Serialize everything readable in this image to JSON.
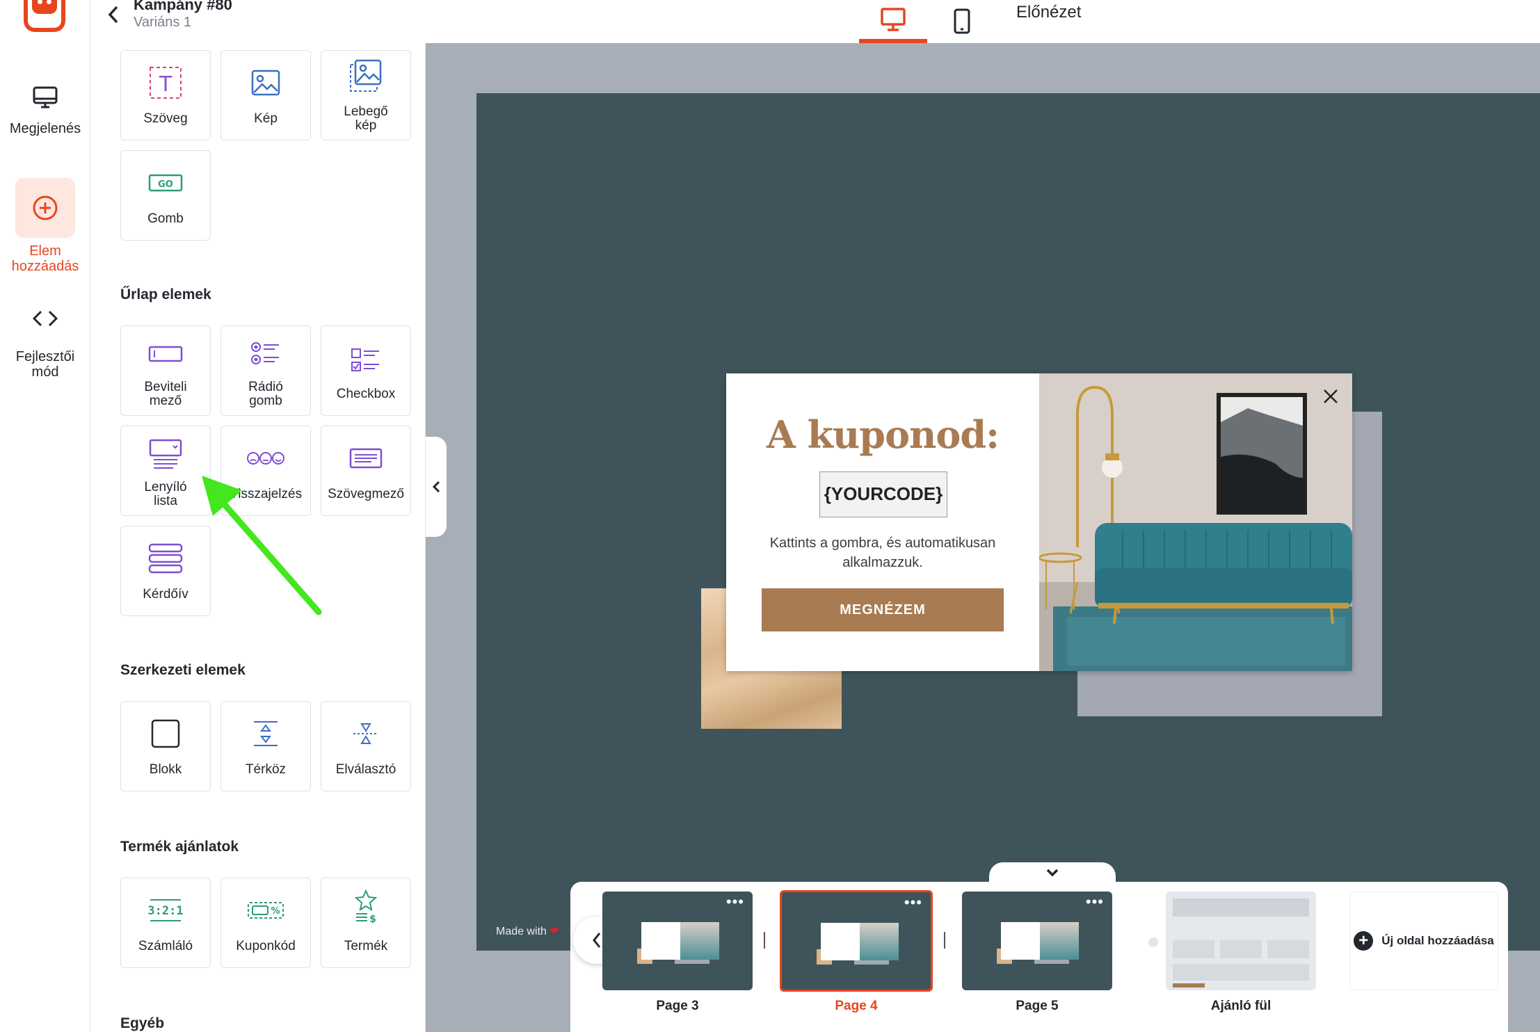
{
  "rail": {
    "items": [
      {
        "label": "Megjelenés",
        "icon": "monitor-icon"
      },
      {
        "label": "Elem hozzáadás",
        "icon": "plus-circle-icon",
        "active": true
      },
      {
        "label": "Fejlesztői mód",
        "icon": "code-icon"
      }
    ]
  },
  "header": {
    "campaign_title": "Kampány #80",
    "variant": "Variáns 1",
    "preview_label": "Előnézet",
    "devices": [
      "desktop-icon",
      "mobile-icon"
    ]
  },
  "panel": {
    "basic_tiles": [
      {
        "label": "Szöveg",
        "icon": "text-icon"
      },
      {
        "label": "Kép",
        "icon": "image-icon"
      },
      {
        "label": "Lebegő kép",
        "icon": "floating-image-icon"
      },
      {
        "label": "Gomb",
        "icon": "go-button-icon"
      }
    ],
    "form_section": "Űrlap elemek",
    "form_tiles": [
      {
        "label": "Beviteli mező",
        "icon": "input-field-icon"
      },
      {
        "label": "Rádió gomb",
        "icon": "radio-icon"
      },
      {
        "label": "Checkbox",
        "icon": "checkbox-icon"
      },
      {
        "label": "Lenyíló lista",
        "icon": "dropdown-icon"
      },
      {
        "label": "Visszajelzés",
        "icon": "feedback-icon"
      },
      {
        "label": "Szövegmező",
        "icon": "textarea-icon"
      },
      {
        "label": "Kérdőív",
        "icon": "survey-icon"
      }
    ],
    "structure_section": "Szerkezeti elemek",
    "structure_tiles": [
      {
        "label": "Blokk",
        "icon": "block-icon"
      },
      {
        "label": "Térköz",
        "icon": "spacer-icon"
      },
      {
        "label": "Elválasztó",
        "icon": "divider-icon"
      }
    ],
    "product_section": "Termék ajánlatok",
    "product_tiles": [
      {
        "label": "Számláló",
        "icon": "counter-icon"
      },
      {
        "label": "Kuponkód",
        "icon": "coupon-icon"
      },
      {
        "label": "Termék",
        "icon": "product-icon"
      }
    ],
    "other_section": "Egyéb"
  },
  "popup": {
    "title": "A kuponod:",
    "code": "{YOURCODE}",
    "description": "Kattints a gombra, és automatikusan alkalmazzuk.",
    "button": "MEGNÉZEM"
  },
  "made_with": "Made with",
  "pages": {
    "items": [
      {
        "label": "Page 3",
        "active": false
      },
      {
        "label": "Page 4",
        "active": true
      },
      {
        "label": "Page 5",
        "active": false
      }
    ],
    "teaser_label": "Ajánló fül",
    "add_label": "Új oldal hozzáadása"
  },
  "colors": {
    "accent": "#e8451e",
    "popup_brown": "#a87b52",
    "stage": "#3f545a",
    "annotation_arrow": "#44e61e"
  }
}
